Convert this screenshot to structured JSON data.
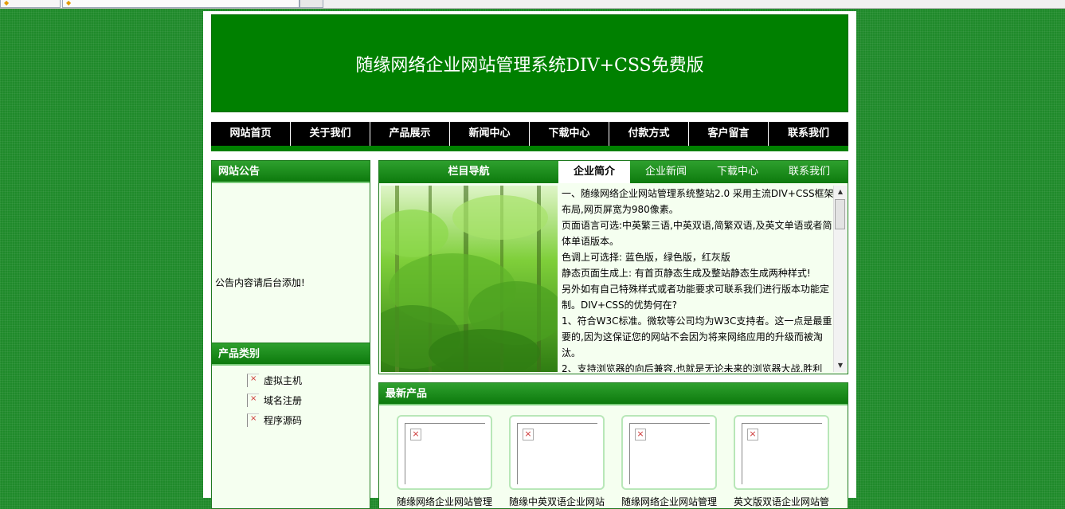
{
  "site": {
    "banner_title": "随缘网络企业网站管理系统DIV+CSS免费版"
  },
  "nav": [
    "网站首页",
    "关于我们",
    "产品展示",
    "新闻中心",
    "下载中心",
    "付款方式",
    "客户留言",
    "联系我们"
  ],
  "notice": {
    "title": "网站公告",
    "text": "公告内容请后台添加!"
  },
  "categories": {
    "title": "产品类别",
    "items": [
      "虚拟主机",
      "域名注册",
      "程序源码"
    ]
  },
  "intro": {
    "section_title": "栏目导航",
    "tabs": [
      "企业简介",
      "企业新闻",
      "下载中心",
      "联系我们"
    ],
    "paragraphs": [
      "一、随缘网络企业网站管理系统整站2.0 采用主流DIV+CSS框架布局,网页屏宽为980像素。",
      "页面语言可选:中英繁三语,中英双语,简繁双语,及英文单语或者简体单语版本。",
      "色调上可选择: 蓝色版，绿色版，红灰版",
      "静态页面生成上: 有首页静态生成及整站静态生成两种样式!",
      "另外如有自己特殊样式或者功能要求可联系我们进行版本功能定制。DIV+CSS的优势何在?",
      "1、符合W3C标准。微软等公司均为W3C支持者。这一点是最重要的,因为这保证您的网站不会因为将来网络应用的升级而被淘汰。",
      "2、支持浏览器的向后兼容,也就是无论未来的浏览器大战,胜利"
    ]
  },
  "products": {
    "title": "最新产品",
    "items": [
      "随缘网络企业网站管理",
      "随缘中英双语企业网站",
      "随缘网络企业网站管理",
      "英文版双语企业网站管"
    ]
  },
  "colors": {
    "page_bg": "#1f8a2a",
    "brand_green": "#008000",
    "nav_bg": "#000000"
  }
}
